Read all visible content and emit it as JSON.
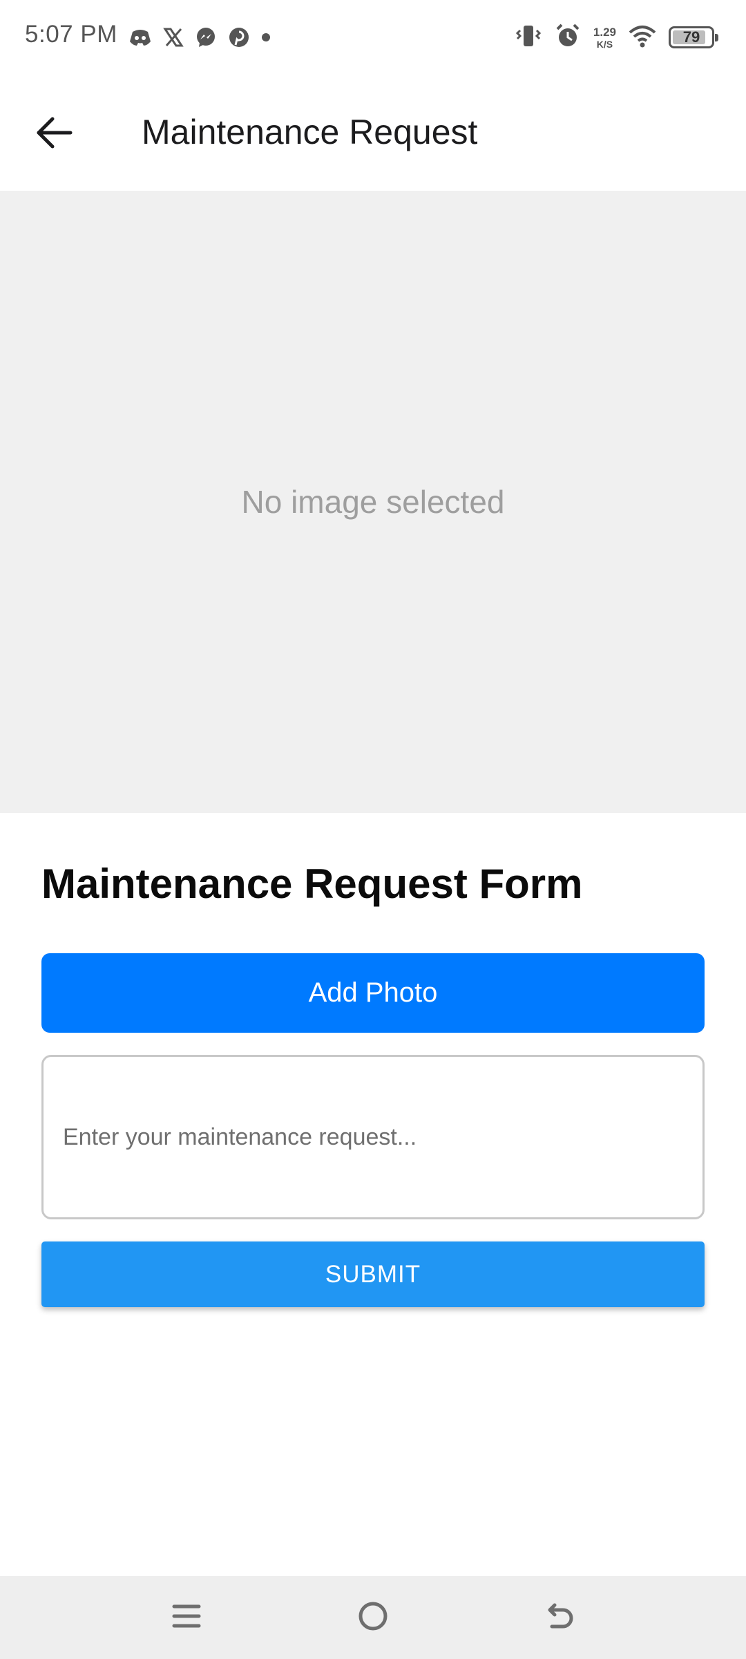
{
  "status_bar": {
    "time": "5:07 PM",
    "notification_icons": [
      "discord-icon",
      "x-icon",
      "messenger-icon",
      "pinterest-icon",
      "dot-icon"
    ],
    "net_speed_value": "1.29",
    "net_speed_unit": "K/S",
    "battery_level": "79"
  },
  "app_bar": {
    "title": "Maintenance Request"
  },
  "image_area": {
    "placeholder_text": "No image selected"
  },
  "form": {
    "title": "Maintenance Request Form",
    "add_photo_label": "Add Photo",
    "request_placeholder": "Enter your maintenance request...",
    "request_value": "",
    "submit_label": "SUBMIT"
  },
  "colors": {
    "add_photo_button": "#007aff",
    "submit_button": "#2196f3",
    "image_area_bg": "#f0f0f0"
  }
}
